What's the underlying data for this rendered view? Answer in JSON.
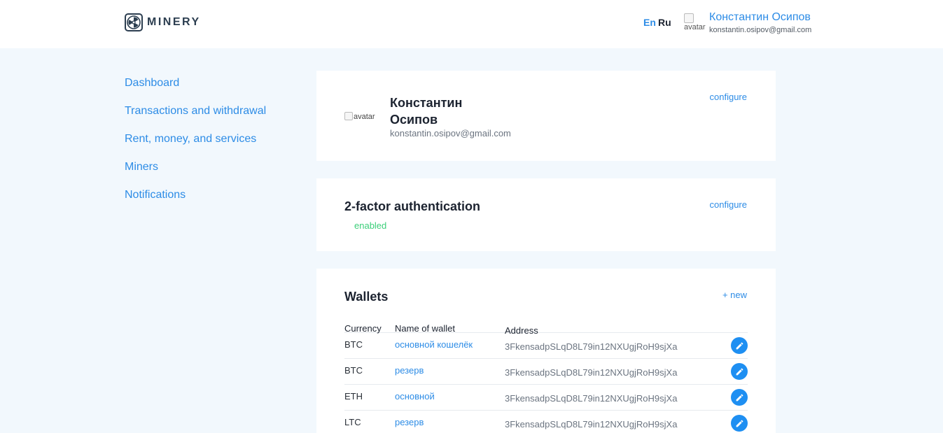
{
  "header": {
    "logo_text": "MINERY",
    "lang_en": "En",
    "lang_ru": "Ru",
    "avatar_alt": "avatar",
    "user_name": "Константин Осипов",
    "user_email": "konstantin.osipov@gmail.com"
  },
  "sidebar": {
    "items": [
      {
        "label": "Dashboard"
      },
      {
        "label": "Transactions and withdrawal"
      },
      {
        "label": "Rent, money, and services"
      },
      {
        "label": "Miners"
      },
      {
        "label": "Notifications"
      }
    ]
  },
  "profile": {
    "avatar_alt": "avatar",
    "name": "Константин Осипов",
    "email": "konstantin.osipov@gmail.com",
    "configure_label": "configure"
  },
  "two_factor": {
    "title": "2-factor authentication",
    "status": "enabled",
    "configure_label": "configure"
  },
  "wallets": {
    "title": "Wallets",
    "new_label": "+ new",
    "columns": [
      "Currency",
      "Name of wallet",
      "Address"
    ],
    "rows": [
      {
        "currency": "BTC",
        "name": "основной кошелёк",
        "address": "3FkensadpSLqD8L79in12NXUgjRoH9sjXa"
      },
      {
        "currency": "BTC",
        "name": "резерв",
        "address": "3FkensadpSLqD8L79in12NXUgjRoH9sjXa"
      },
      {
        "currency": "ETH",
        "name": "основной",
        "address": "3FkensadpSLqD8L79in12NXUgjRoH9sjXa"
      },
      {
        "currency": "LTC",
        "name": "резерв",
        "address": "3FkensadpSLqD8L79in12NXUgjRoH9sjXa"
      }
    ]
  },
  "colors": {
    "accent": "#2d8ce6",
    "status_enabled": "#3ccf7a",
    "page_background": "#f2f8fd",
    "edit_button": "#1e8ff2"
  },
  "icons": {
    "logo": "minery-fan-icon",
    "edit": "pencil-icon"
  }
}
